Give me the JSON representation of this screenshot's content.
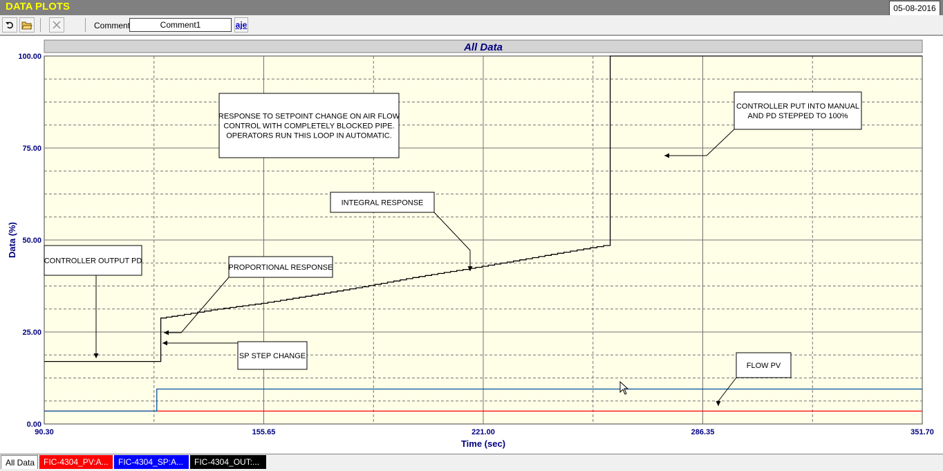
{
  "app": {
    "title": "DATA PLOTS",
    "date": "05-08-2016"
  },
  "toolbar": {
    "undo_icon": "undo-icon",
    "open_icon": "open-folder-icon",
    "delete_icon": "close-x-icon",
    "comment_label": "Comment",
    "comment_value": "Comment1",
    "spell_label": "aje"
  },
  "tabs": [
    {
      "label": "All Data",
      "color": "#ffffff",
      "text_color": "#000000"
    },
    {
      "label": "FIC-4304_PV:A...",
      "color": "#ff0000",
      "text_color": "#ffffff"
    },
    {
      "label": "FIC-4304_SP:A...",
      "color": "#0000ff",
      "text_color": "#ffffff"
    },
    {
      "label": "FIC-4304_OUT:...",
      "color": "#000000",
      "text_color": "#ffffff"
    }
  ],
  "chart_data": {
    "type": "line",
    "title": "All Data",
    "xlabel": "Time (sec)",
    "ylabel": "Data (%)",
    "xlim": [
      90.3,
      351.7
    ],
    "ylim": [
      0,
      100
    ],
    "x_ticks": [
      "90.30",
      "155.65",
      "221.00",
      "286.35",
      "351.70"
    ],
    "y_ticks": [
      "0.00",
      "25.00",
      "50.00",
      "75.00",
      "100.00"
    ],
    "grid": true,
    "background": "#ffffe8",
    "series": [
      {
        "name": "FIC-4304_OUT",
        "color": "#000000",
        "x": [
          90.3,
          125.0,
          125.0,
          130.0,
          140.0,
          155.0,
          170.0,
          185.0,
          200.0,
          215.0,
          230.0,
          245.0,
          258.8,
          258.8,
          351.7
        ],
        "y": [
          17.0,
          17.0,
          28.8,
          29.5,
          31.0,
          32.8,
          35.0,
          37.3,
          39.8,
          42.0,
          44.3,
          46.7,
          48.8,
          100.0,
          100.0
        ]
      },
      {
        "name": "FIC-4304_SP",
        "color": "#0050a0",
        "x": [
          90.3,
          123.8,
          123.8,
          351.7
        ],
        "y": [
          3.5,
          3.5,
          9.5,
          9.5
        ]
      },
      {
        "name": "FIC-4304_PV",
        "color": "#ff0000",
        "x": [
          90.3,
          351.7
        ],
        "y": [
          3.5,
          3.5
        ]
      }
    ],
    "annotations": [
      {
        "lines": [
          "RESPONSE TO SETPOINT CHANGE ON AIR FLOW",
          "CONTROL WITH COMPLETELY BLOCKED PIPE.",
          "OPERATORS RUN THIS LOOP IN AUTOMATIC."
        ]
      },
      {
        "lines": [
          "CONTROLLER PUT INTO MANUAL",
          "AND PD STEPPED TO 100%"
        ]
      },
      {
        "lines": [
          "INTEGRAL RESPONSE"
        ]
      },
      {
        "lines": [
          "CONTROLLER OUTPUT PD"
        ]
      },
      {
        "lines": [
          "PROPORTIONAL RESPONSE"
        ]
      },
      {
        "lines": [
          "SP STEP CHANGE"
        ]
      },
      {
        "lines": [
          "FLOW PV"
        ]
      }
    ]
  }
}
